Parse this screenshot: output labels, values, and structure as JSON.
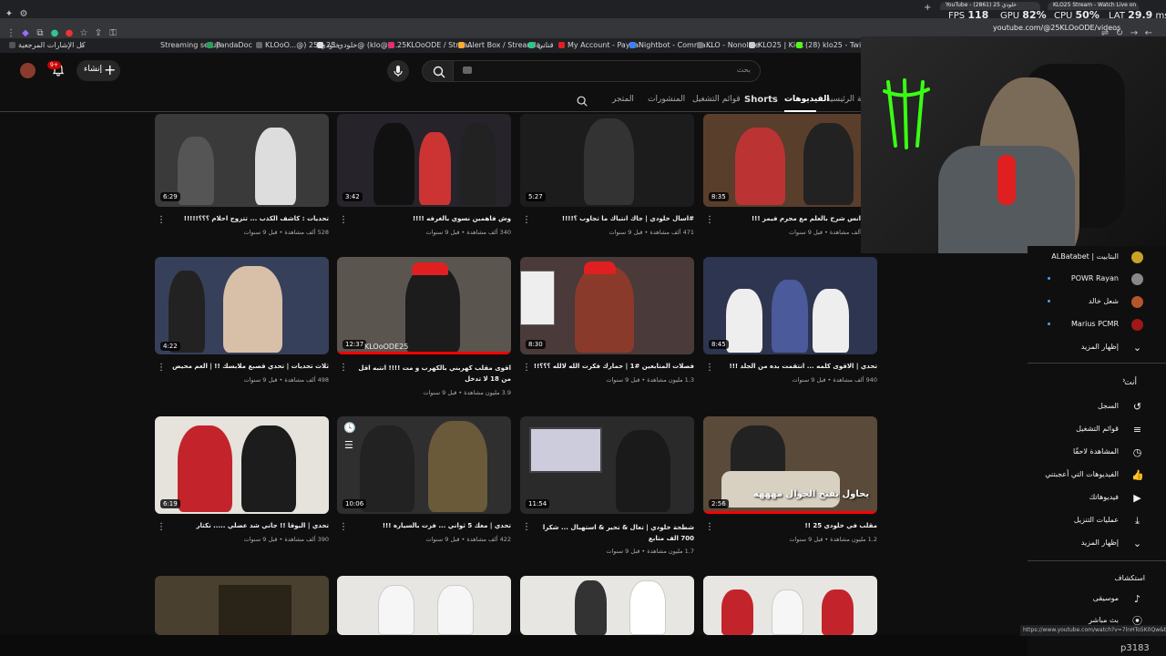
{
  "browser": {
    "bookmarks": [
      {
        "label": "كل الإشارات المرجعية",
        "color": "#555"
      },
      {
        "label": "Streaming setup",
        "color": "#777"
      },
      {
        "label": "PandaDoc",
        "color": "#2a9d5c"
      },
      {
        "label": "KLOoO...@) خلودي 25",
        "color": "#666"
      },
      {
        "label": "خلودي 25@ (klo@) ...",
        "color": "#ddd"
      },
      {
        "label": "25KLOoODE / Strea...",
        "color": "#e1306c"
      },
      {
        "label": "Alert Box / Streamla...",
        "color": "#fa3"
      },
      {
        "label": "قناتي",
        "color": "#31c48d"
      },
      {
        "label": "My Account - PayPal",
        "color": "#e02020"
      },
      {
        "label": "Nightbot - Comma...",
        "color": "#3b82f6"
      },
      {
        "label": "KLO - Nonolive",
        "color": "#777"
      },
      {
        "label": "KLO25 | Kick",
        "color": "#ccc"
      },
      {
        "label": "(28) klo25 - Twitch",
        "color": "#53fc18"
      }
    ],
    "tabs": [
      {
        "label": "YouTube - خلودي 25 (2861)"
      },
      {
        "label": "KLO25 Stream - Watch Live on"
      }
    ],
    "url": "youtube.com/@25KLOoODE/videos",
    "status_url": "https://www.youtube.com/watch?v=7lnHTo5K0Qw&t=222s"
  },
  "perf": {
    "fps_label": "FPS",
    "fps": "118",
    "gpu_label": "GPU",
    "gpu": "82",
    "cpu_label": "CPU",
    "cpu": "50",
    "lat_label": "LAT",
    "lat": "29.9",
    "percent": "%",
    "ms": "ms"
  },
  "youtube": {
    "search_placeholder": "بحث",
    "create_label": "إنشاء",
    "notif_count": "9+",
    "tabs": [
      "الصفحة الرئيسية",
      "الفيديوهات",
      "Shorts",
      "قوائم التشغيل",
      "المنشورات",
      "المتجر"
    ],
    "active_tab": "الفيديوهات"
  },
  "videos": [
    {
      "title": "تحديات : كاشف الكذب ... تتزوج احلام ؟؟؟!!!!!",
      "meta": "528 ألف مشاهدة • قبل 9 سنوات",
      "duration": "6:29",
      "bg": "#3a3a3a"
    },
    {
      "title": "وش فاهمين نسوي بالغرفه !!!!",
      "meta": "340 ألف مشاهدة • قبل 9 سنوات",
      "duration": "3:42",
      "bg": "#26232a"
    },
    {
      "title": "#اسال خلودي | جاك انتباك ما تجاوب ؟!!!!",
      "meta": "471 ألف مشاهدة • قبل 9 سنوات",
      "duration": "5:27",
      "bg": "#1c1c1c"
    },
    {
      "title": "انس شرح بالعلم مع مجرم فيمز !!!",
      "meta": "ألف مشاهدة • قبل 9 سنوات",
      "duration": "8:35",
      "bg": "#5a3e2c"
    },
    {
      "title": "ثلاث تحديات | تحدي قصبع ملابسك !! | العم محيض",
      "meta": "498 ألف مشاهدة • قبل 9 سنوات",
      "duration": "4:22",
      "bg": "#36405a"
    },
    {
      "title": "اقوى مقلب كهربني بالكهرب و مت !!!! انتبه اقل من 18 لا تدخل",
      "meta": "3.9 مليون مشاهدة • قبل 9 سنوات",
      "duration": "12:37",
      "bg": "#5b5550"
    },
    {
      "title": "فصلات المتابعين #1 | حمارك فكرت الله لالله ؟؟؟!!",
      "meta": "1.3 مليون مشاهدة • قبل 9 سنوات",
      "duration": "8:30",
      "bg": "#4a3a3a"
    },
    {
      "title": "تحدي | الاقوى كلمه ... انتقمت بده من الجلد !!!",
      "meta": "940 ألف مشاهدة • قبل 9 سنوات",
      "duration": "8:45",
      "bg": "#2e3550"
    },
    {
      "title": "تحدي | البوقا !! جاني شد عضلي ..... نكتار",
      "meta": "390 ألف مشاهدة • قبل 9 سنوات",
      "duration": "6:19",
      "bg": "#e6e2dc"
    },
    {
      "title": "تحدي | معك 5 ثواني ... فزت بالسياره !!!",
      "meta": "422 ألف مشاهدة • قبل 9 سنوات",
      "duration": "10:06",
      "bg": "#2f2f2f"
    },
    {
      "title": "شطحة خلودي | تعال & تحير & استهبال ... شكرا 700 الف متابع",
      "meta": "1.7 مليون مشاهدة • قبل 9 سنوات",
      "duration": "11:54",
      "bg": "#2a2a2a"
    },
    {
      "title": "مقلب في خلودي 25 !!",
      "meta": "1.2 مليون مشاهدة • قبل 9 سنوات",
      "duration": "2:56",
      "bg": "#5a4a3a",
      "overlay": "يحاول يفتح الجوال مهههه"
    }
  ],
  "bottom_row_bgs": [
    "#4a4030",
    "#e8e6e2",
    "#e8e6e2",
    "#e8e6e2"
  ],
  "watermark": "KLOoODE25",
  "sidebar": {
    "subs": [
      {
        "label": "ALBatabet | البتابيت",
        "color": "#c9a227"
      },
      {
        "label": "POWR Rayan",
        "color": "#888"
      },
      {
        "label": "شعل خالد",
        "color": "#b5562a"
      },
      {
        "label": "Marius PCMR",
        "color": "#a01818"
      }
    ],
    "show_more_1": "إظهار المزيد",
    "you_heading": "أنت",
    "you_items": [
      {
        "label": "السجل",
        "icon": "history-icon"
      },
      {
        "label": "قوائم التشغيل",
        "icon": "playlists-icon"
      },
      {
        "label": "المشاهدة لاحقًا",
        "icon": "watch-later-icon"
      },
      {
        "label": "الفيديوهات التي أعجبتني",
        "icon": "like-icon"
      },
      {
        "label": "فيديوهاتك",
        "icon": "your-videos-icon"
      },
      {
        "label": "عمليات التنزيل",
        "icon": "download-icon"
      }
    ],
    "show_more_2": "إظهار المزيد",
    "explore_heading": "استكشاف",
    "explore_items": [
      {
        "label": "موسيقى",
        "icon": "music-icon"
      },
      {
        "label": "بث مباشر",
        "icon": "live-icon"
      }
    ]
  },
  "footer_tag": "p3183"
}
